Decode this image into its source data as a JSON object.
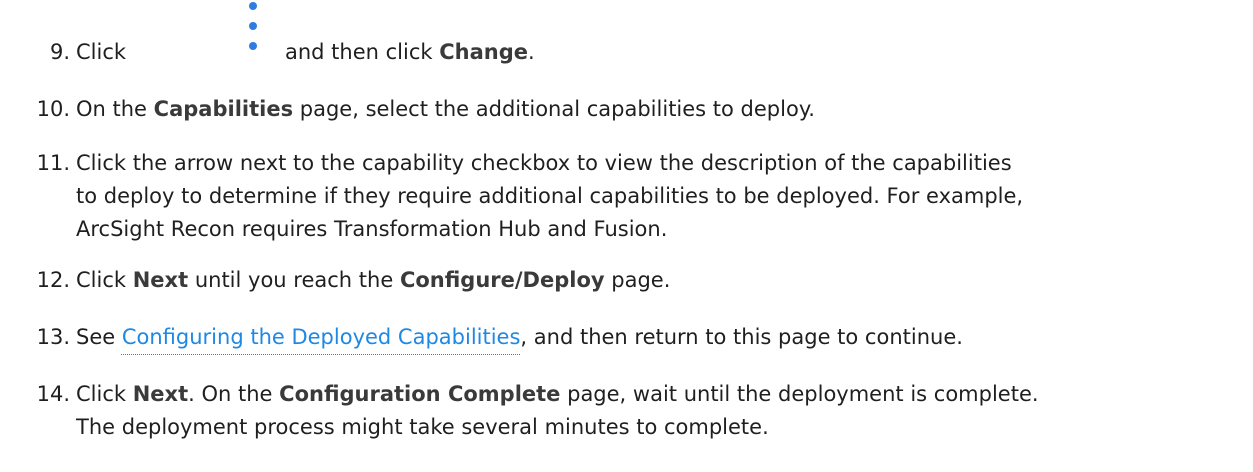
{
  "steps": [
    {
      "number": "9.",
      "text_before": "Click",
      "icon": "vertical-ellipsis-icon",
      "text_mid": "and then click",
      "bold": "Change",
      "text_after": "."
    },
    {
      "number": "10.",
      "t1": "On the",
      "b1": "Capabilities",
      "t2": "page, select the additional capabilities to deploy."
    },
    {
      "number": "11.",
      "lines": [
        "Click the arrow next to the capability checkbox to view the description of the capabilities",
        "to deploy to determine if they require additional capabilities to be deployed. For example,",
        "ArcSight Recon requires Transformation Hub and Fusion."
      ]
    },
    {
      "number": "12.",
      "t1": "Click",
      "b1": "Next",
      "t2": "until you reach the",
      "b2": "Configure/Deploy",
      "t3": "page."
    },
    {
      "number": "13.",
      "t1": "See",
      "link": "Configuring the Deployed Capabilities",
      "t2": ", and then return to this page to continue."
    },
    {
      "number": "14.",
      "t1": "Click",
      "b1": "Next",
      "t2": ". On the",
      "b2": "Configuration Complete",
      "t3": "page, wait until the deployment is complete.",
      "line2": "The deployment process might take several minutes to complete."
    }
  ],
  "colors": {
    "text": "#1f1f1f",
    "bold_text": "#3a3a3a",
    "link": "#1e88e5",
    "icon": "#2f7de1"
  }
}
